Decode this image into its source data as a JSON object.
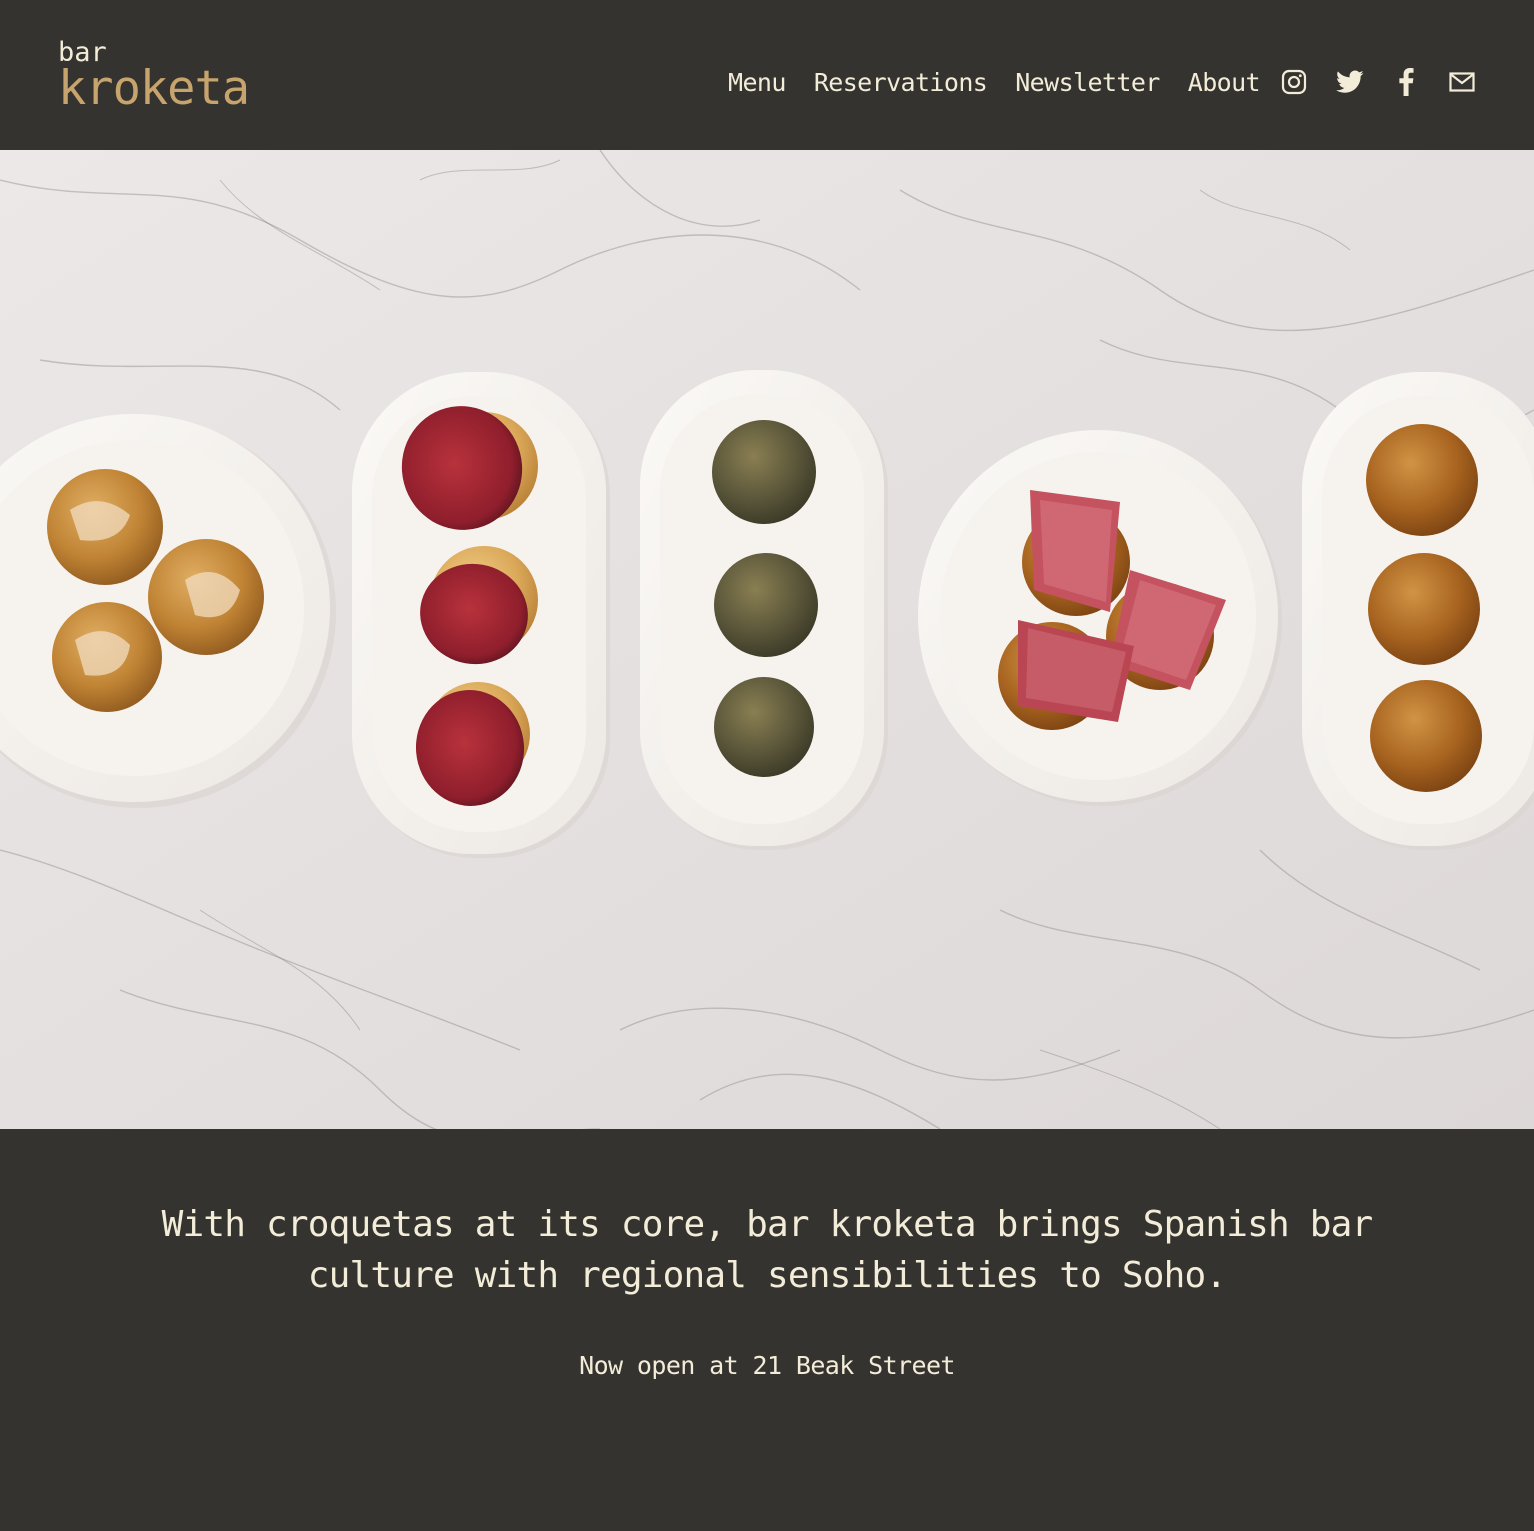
{
  "brand": {
    "small": "bar",
    "name": "kroketa",
    "accent_color": "#c7a36d",
    "background_color": "#34332f",
    "text_color": "#f2ecd8"
  },
  "nav": {
    "items": [
      {
        "label": "Menu"
      },
      {
        "label": "Reservations"
      },
      {
        "label": "Newsletter"
      },
      {
        "label": "About"
      }
    ]
  },
  "social": [
    {
      "icon": "instagram-icon"
    },
    {
      "icon": "twitter-icon"
    },
    {
      "icon": "facebook-icon"
    },
    {
      "icon": "email-icon"
    }
  ],
  "hero": {
    "image": "croquetas-on-plates-over-marble"
  },
  "intro": {
    "tagline": "With croquetas at its core, bar kroketa brings Spanish bar culture with regional sensibilities to Soho.",
    "address": "Now open at 21 Beak Street"
  }
}
